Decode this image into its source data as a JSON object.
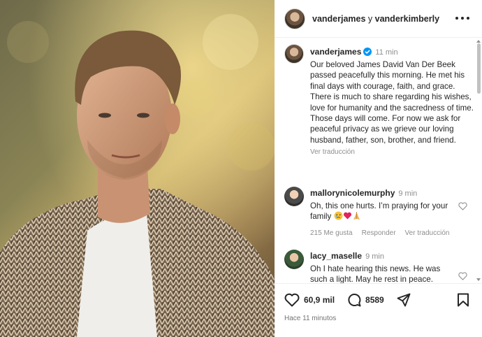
{
  "header": {
    "user1": "vanderjames",
    "joiner": " y ",
    "user2": "vanderkimberly"
  },
  "caption": {
    "username": "vanderjames",
    "time": "11 min",
    "text": "Our beloved James David Van Der Beek passed peacefully this morning.  He met his final days with courage, faith, and grace.  There is much to share regarding his wishes, love for humanity and the sacredness of time.  Those days will come.  For now we ask for peaceful privacy as we grieve our loving husband, father, son, brother, and friend.",
    "translate": "Ver traducción"
  },
  "comments": [
    {
      "username": "mallorynicolemurphy",
      "time": "9 min",
      "text": "Oh, this one hurts. I’m praying for your family",
      "emojis": [
        "crying-face",
        "red-heart",
        "folded-hands"
      ],
      "likes": "215 Me gusta",
      "reply": "Responder",
      "translate": "Ver traducción"
    },
    {
      "username": "lacy_maselle",
      "time": "9 min",
      "text": "Oh I hate hearing this news. He was such a light. May he rest in peace."
    }
  ],
  "actions": {
    "likes": "60,9 mil",
    "comments": "8589"
  },
  "timestamp": "Hace 11 minutos",
  "colors": {
    "verified": "#0095f6",
    "text": "#262626",
    "muted": "#8e8e8e"
  }
}
